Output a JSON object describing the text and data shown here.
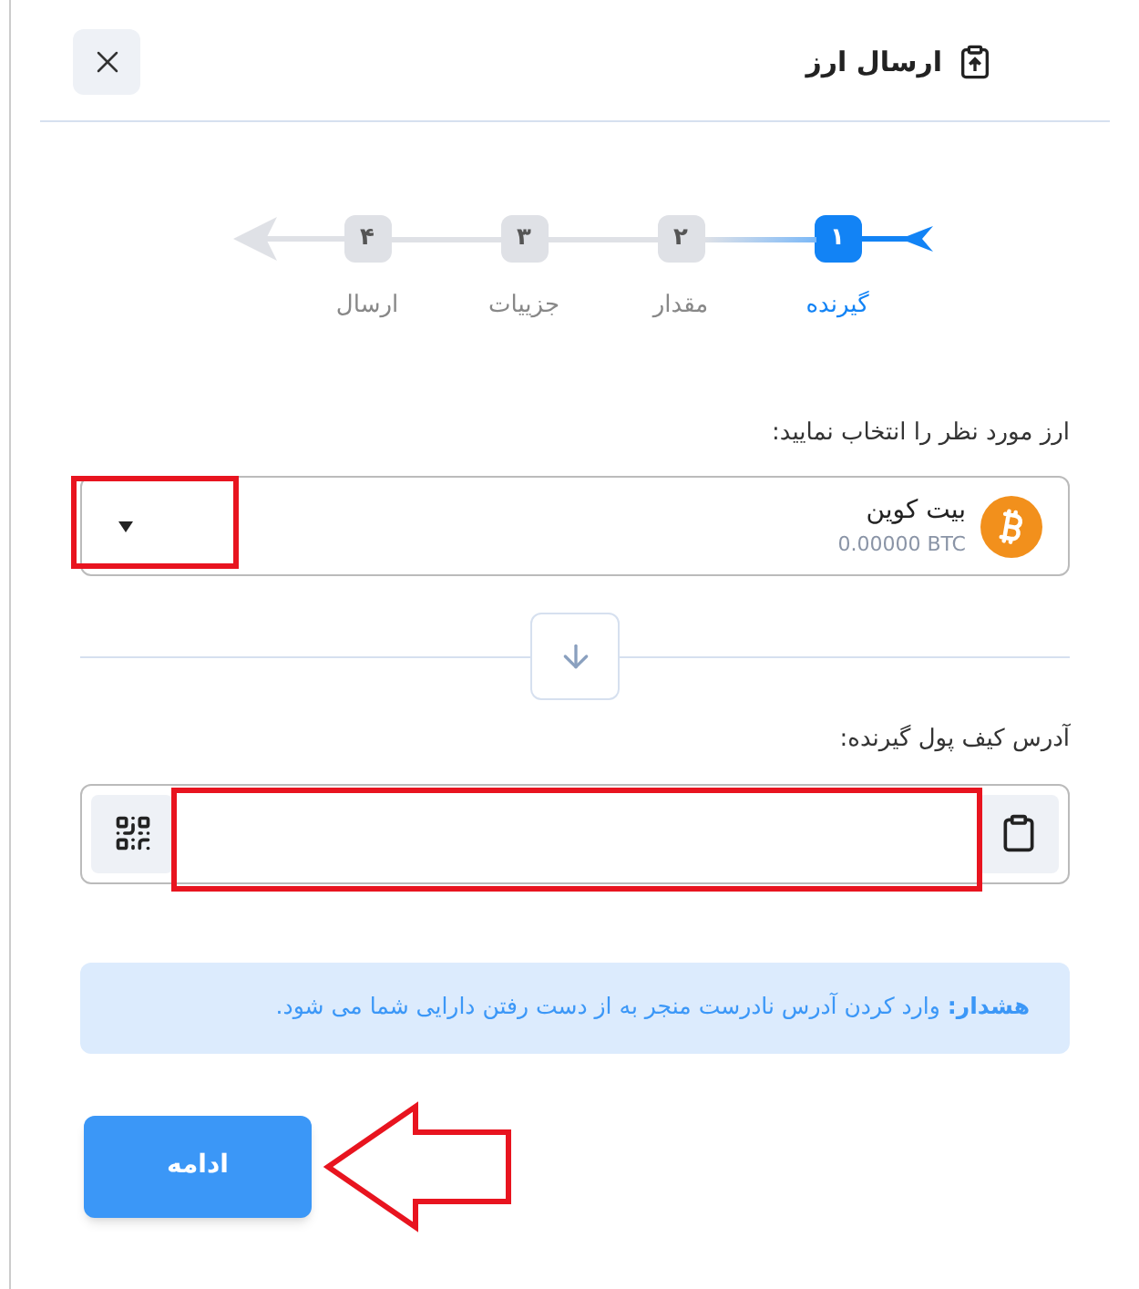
{
  "dialog": {
    "title": "ارسال ارز"
  },
  "steps": [
    {
      "number": "۱",
      "label": "گیرنده",
      "selected": true
    },
    {
      "number": "۲",
      "label": "مقدار",
      "selected": false
    },
    {
      "number": "۳",
      "label": "جزییات",
      "selected": false
    },
    {
      "number": "۴",
      "label": "ارسال",
      "selected": false
    }
  ],
  "currency": {
    "label": "ارز مورد نظر را انتخاب نمایید:",
    "name": "بیت کوین",
    "balance": "0.00000 BTC"
  },
  "address": {
    "label": "آدرس کیف پول گیرنده:"
  },
  "warning": "**هشدار:** وارد کردن آدرس نادرست منجر به از دست رفتن دارایی شما می شود.",
  "continue_button": "ادامه"
}
